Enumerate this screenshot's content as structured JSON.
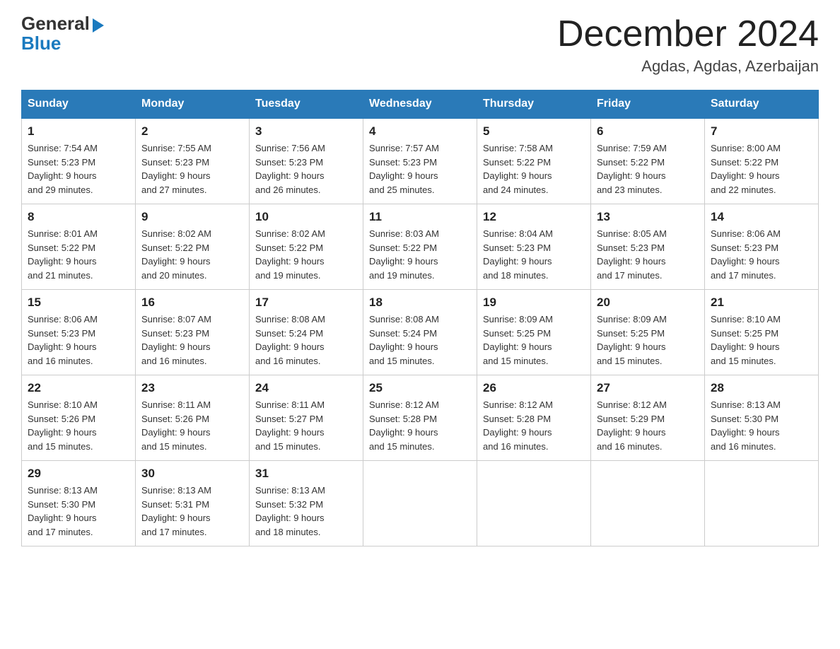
{
  "header": {
    "logo_general": "General",
    "logo_blue": "Blue",
    "month_year": "December 2024",
    "location": "Agdas, Agdas, Azerbaijan"
  },
  "days_of_week": [
    "Sunday",
    "Monday",
    "Tuesday",
    "Wednesday",
    "Thursday",
    "Friday",
    "Saturday"
  ],
  "weeks": [
    [
      {
        "day": "1",
        "sunrise": "7:54 AM",
        "sunset": "5:23 PM",
        "daylight": "9 hours and 29 minutes."
      },
      {
        "day": "2",
        "sunrise": "7:55 AM",
        "sunset": "5:23 PM",
        "daylight": "9 hours and 27 minutes."
      },
      {
        "day": "3",
        "sunrise": "7:56 AM",
        "sunset": "5:23 PM",
        "daylight": "9 hours and 26 minutes."
      },
      {
        "day": "4",
        "sunrise": "7:57 AM",
        "sunset": "5:23 PM",
        "daylight": "9 hours and 25 minutes."
      },
      {
        "day": "5",
        "sunrise": "7:58 AM",
        "sunset": "5:22 PM",
        "daylight": "9 hours and 24 minutes."
      },
      {
        "day": "6",
        "sunrise": "7:59 AM",
        "sunset": "5:22 PM",
        "daylight": "9 hours and 23 minutes."
      },
      {
        "day": "7",
        "sunrise": "8:00 AM",
        "sunset": "5:22 PM",
        "daylight": "9 hours and 22 minutes."
      }
    ],
    [
      {
        "day": "8",
        "sunrise": "8:01 AM",
        "sunset": "5:22 PM",
        "daylight": "9 hours and 21 minutes."
      },
      {
        "day": "9",
        "sunrise": "8:02 AM",
        "sunset": "5:22 PM",
        "daylight": "9 hours and 20 minutes."
      },
      {
        "day": "10",
        "sunrise": "8:02 AM",
        "sunset": "5:22 PM",
        "daylight": "9 hours and 19 minutes."
      },
      {
        "day": "11",
        "sunrise": "8:03 AM",
        "sunset": "5:22 PM",
        "daylight": "9 hours and 19 minutes."
      },
      {
        "day": "12",
        "sunrise": "8:04 AM",
        "sunset": "5:23 PM",
        "daylight": "9 hours and 18 minutes."
      },
      {
        "day": "13",
        "sunrise": "8:05 AM",
        "sunset": "5:23 PM",
        "daylight": "9 hours and 17 minutes."
      },
      {
        "day": "14",
        "sunrise": "8:06 AM",
        "sunset": "5:23 PM",
        "daylight": "9 hours and 17 minutes."
      }
    ],
    [
      {
        "day": "15",
        "sunrise": "8:06 AM",
        "sunset": "5:23 PM",
        "daylight": "9 hours and 16 minutes."
      },
      {
        "day": "16",
        "sunrise": "8:07 AM",
        "sunset": "5:23 PM",
        "daylight": "9 hours and 16 minutes."
      },
      {
        "day": "17",
        "sunrise": "8:08 AM",
        "sunset": "5:24 PM",
        "daylight": "9 hours and 16 minutes."
      },
      {
        "day": "18",
        "sunrise": "8:08 AM",
        "sunset": "5:24 PM",
        "daylight": "9 hours and 15 minutes."
      },
      {
        "day": "19",
        "sunrise": "8:09 AM",
        "sunset": "5:25 PM",
        "daylight": "9 hours and 15 minutes."
      },
      {
        "day": "20",
        "sunrise": "8:09 AM",
        "sunset": "5:25 PM",
        "daylight": "9 hours and 15 minutes."
      },
      {
        "day": "21",
        "sunrise": "8:10 AM",
        "sunset": "5:25 PM",
        "daylight": "9 hours and 15 minutes."
      }
    ],
    [
      {
        "day": "22",
        "sunrise": "8:10 AM",
        "sunset": "5:26 PM",
        "daylight": "9 hours and 15 minutes."
      },
      {
        "day": "23",
        "sunrise": "8:11 AM",
        "sunset": "5:26 PM",
        "daylight": "9 hours and 15 minutes."
      },
      {
        "day": "24",
        "sunrise": "8:11 AM",
        "sunset": "5:27 PM",
        "daylight": "9 hours and 15 minutes."
      },
      {
        "day": "25",
        "sunrise": "8:12 AM",
        "sunset": "5:28 PM",
        "daylight": "9 hours and 15 minutes."
      },
      {
        "day": "26",
        "sunrise": "8:12 AM",
        "sunset": "5:28 PM",
        "daylight": "9 hours and 16 minutes."
      },
      {
        "day": "27",
        "sunrise": "8:12 AM",
        "sunset": "5:29 PM",
        "daylight": "9 hours and 16 minutes."
      },
      {
        "day": "28",
        "sunrise": "8:13 AM",
        "sunset": "5:30 PM",
        "daylight": "9 hours and 16 minutes."
      }
    ],
    [
      {
        "day": "29",
        "sunrise": "8:13 AM",
        "sunset": "5:30 PM",
        "daylight": "9 hours and 17 minutes."
      },
      {
        "day": "30",
        "sunrise": "8:13 AM",
        "sunset": "5:31 PM",
        "daylight": "9 hours and 17 minutes."
      },
      {
        "day": "31",
        "sunrise": "8:13 AM",
        "sunset": "5:32 PM",
        "daylight": "9 hours and 18 minutes."
      },
      null,
      null,
      null,
      null
    ]
  ],
  "labels": {
    "sunrise": "Sunrise:",
    "sunset": "Sunset:",
    "daylight": "Daylight:"
  }
}
